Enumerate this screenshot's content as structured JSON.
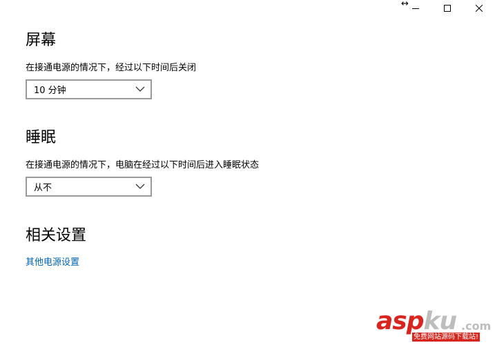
{
  "titlebar": {
    "resize_icon": "resize-arrows-icon",
    "minimize_icon": "minimize-icon",
    "maximize_icon": "maximize-icon",
    "close_icon": "close-icon"
  },
  "screen": {
    "title": "屏幕",
    "description": "在接通电源的情况下，经过以下时间后关闭",
    "selected": "10 分钟"
  },
  "sleep": {
    "title": "睡眠",
    "description": "在接通电源的情况下，电脑在经过以下时间后进入睡眠状态",
    "selected": "从不"
  },
  "related": {
    "title": "相关设置",
    "link_label": "其他电源设置"
  },
  "watermark": {
    "brand_red": "asp",
    "brand_gray": "ku",
    "suffix": ".com",
    "tagline": "免费网站源码下载站!"
  },
  "colors": {
    "link": "#0063b1",
    "dropdown_border": "#9a9a9a",
    "watermark_red": "#d8261e"
  }
}
